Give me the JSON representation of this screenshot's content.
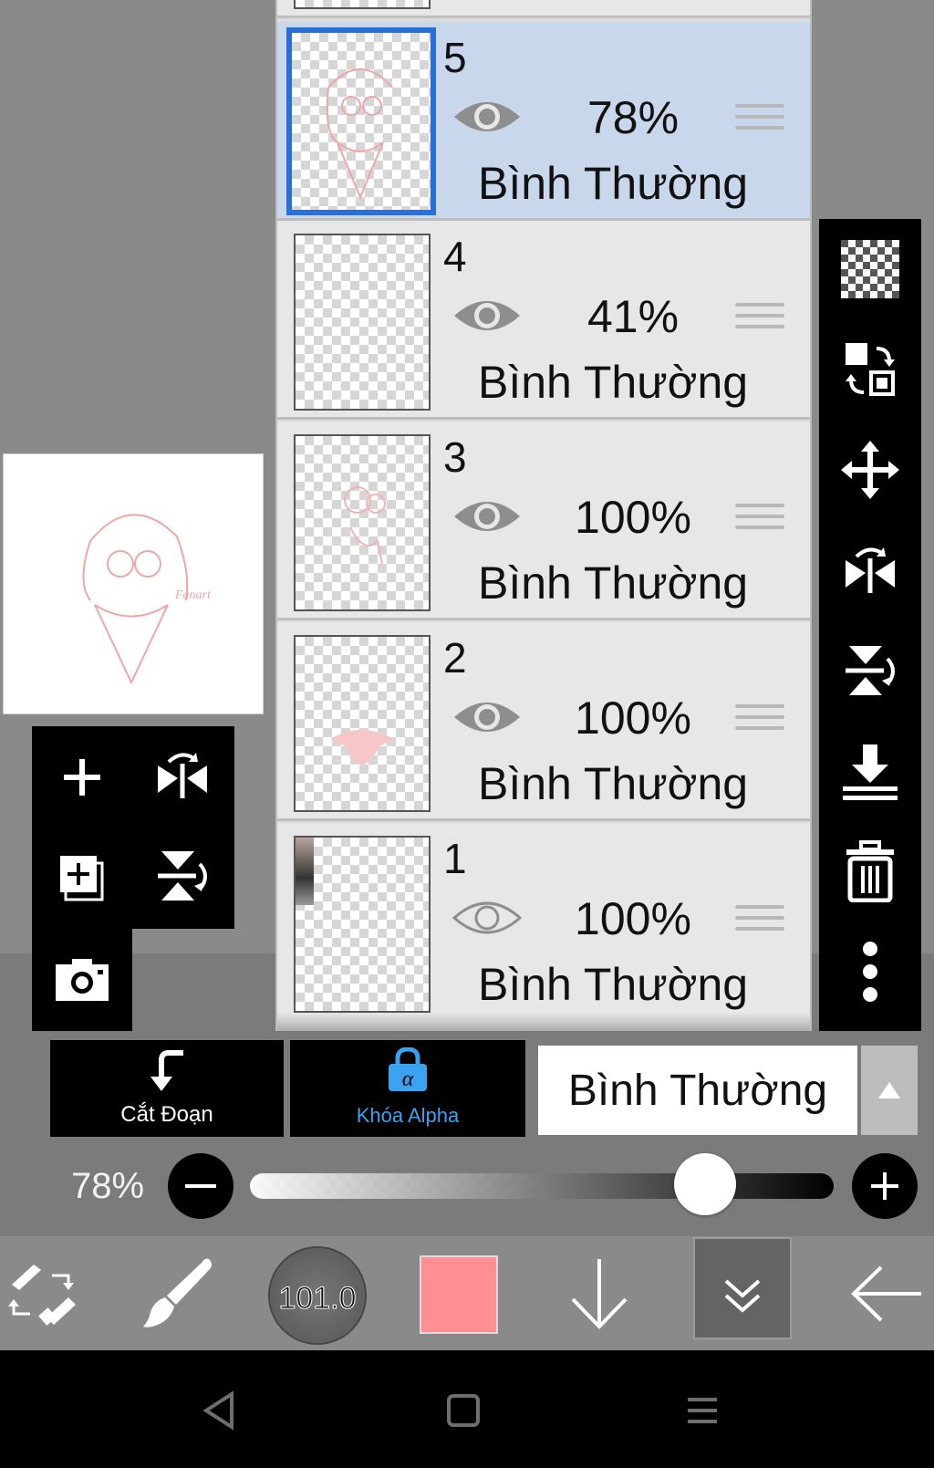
{
  "layers": [
    {
      "number": "5",
      "opacity": "78%",
      "mode": "Bình Thường",
      "selected": true,
      "visible": true
    },
    {
      "number": "4",
      "opacity": "41%",
      "mode": "Bình Thường",
      "selected": false,
      "visible": true
    },
    {
      "number": "3",
      "opacity": "100%",
      "mode": "Bình Thường",
      "selected": false,
      "visible": true
    },
    {
      "number": "2",
      "opacity": "100%",
      "mode": "Bình Thường",
      "selected": false,
      "visible": true
    },
    {
      "number": "1",
      "opacity": "100%",
      "mode": "Bình Thường",
      "selected": false,
      "visible": false
    }
  ],
  "controls": {
    "clip_label": "Cắt Đoạn",
    "alpha_lock_label": "Khóa Alpha",
    "blend_mode": "Bình Thường",
    "opacity_label": "78%",
    "opacity_value": 0.78
  },
  "toolbar": {
    "brush_size": "101.0",
    "color": "#ff8f92"
  },
  "preview": {
    "caption": "Fanart"
  }
}
